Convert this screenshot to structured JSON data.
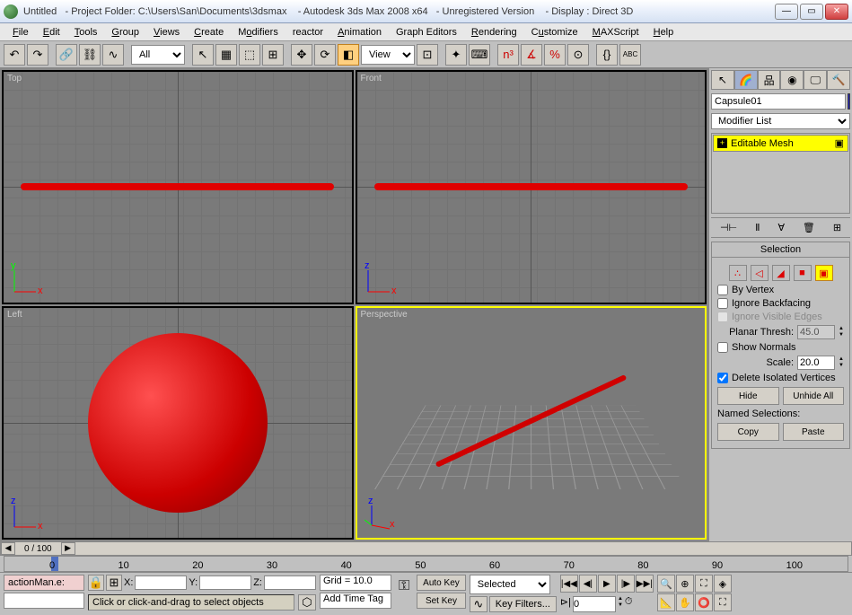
{
  "title": {
    "doc": "Untitled",
    "folder_label": "- Project Folder:",
    "folder_path": "C:\\Users\\San\\Documents\\3dsmax",
    "app": "- Autodesk 3ds Max 2008 x64",
    "reg": "- Unregistered Version",
    "display": "- Display : Direct 3D"
  },
  "menu": [
    "File",
    "Edit",
    "Tools",
    "Group",
    "Views",
    "Create",
    "Modifiers",
    "reactor",
    "Animation",
    "Graph Editors",
    "Rendering",
    "Customize",
    "MAXScript",
    "Help"
  ],
  "toolbar": {
    "filter": "All",
    "refcoord": "View"
  },
  "viewports": {
    "top": "Top",
    "front": "Front",
    "left": "Left",
    "persp": "Perspective"
  },
  "panel": {
    "obj_name": "Capsule01",
    "mod_list": "Modifier List",
    "mod_stack_item": "Editable Mesh",
    "rollout_title": "Selection",
    "by_vertex": "By Vertex",
    "ignore_backfacing": "Ignore Backfacing",
    "ignore_visible_edges": "Ignore Visible Edges",
    "planar_thresh": "Planar Thresh:",
    "planar_val": "45.0",
    "show_normals": "Show Normals",
    "scale_label": "Scale:",
    "scale_val": "20.0",
    "delete_iso": "Delete Isolated Vertices",
    "hide": "Hide",
    "unhide": "Unhide All",
    "named_sel": "Named Selections:",
    "copy": "Copy",
    "paste": "Paste"
  },
  "timeline": {
    "frame_disp": "0 / 100",
    "ticks": [
      "0",
      "10",
      "20",
      "30",
      "40",
      "50",
      "60",
      "70",
      "80",
      "90",
      "100"
    ]
  },
  "status": {
    "script": "actionMan.e:",
    "x": "X:",
    "y": "Y:",
    "z": "Z:",
    "grid": "Grid = 10.0",
    "autokey": "Auto Key",
    "setkey": "Set Key",
    "selected": "Selected",
    "keyfilters": "Key Filters...",
    "addtag": "Add Time Tag",
    "prompt": "Click or click-and-drag to select objects",
    "frame_val": "0"
  }
}
